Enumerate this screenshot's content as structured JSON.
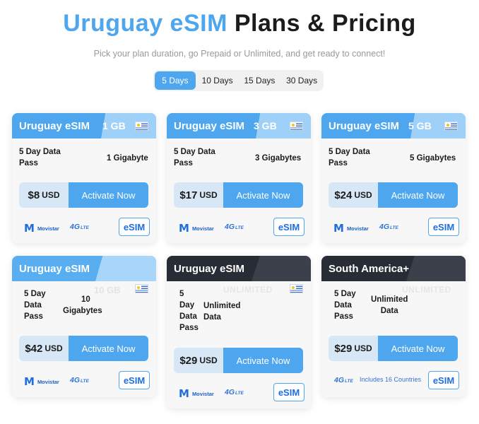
{
  "header": {
    "title_accent": "Uruguay eSIM",
    "title_rest": "Plans & Pricing",
    "subtitle": "Pick your plan duration, go Prepaid or Unlimited, and get ready to connect!"
  },
  "tabs": [
    {
      "label": "5 Days",
      "active": true
    },
    {
      "label": "10 Days",
      "active": false
    },
    {
      "label": "15 Days",
      "active": false
    },
    {
      "label": "30 Days",
      "active": false
    }
  ],
  "cards": [
    {
      "title": "Uruguay eSIM",
      "data_badge": "1 GB",
      "desc": [
        "5 Day Data",
        "Pass"
      ],
      "amount": [
        "1 Gigabyte"
      ],
      "price": "$8",
      "currency": "USD",
      "cta": "Activate Now",
      "carrier": "Movistar",
      "network": "4G",
      "network_sub": "LTE",
      "badge": "eSIM"
    },
    {
      "title": "Uruguay eSIM",
      "data_badge": "3 GB",
      "desc": [
        "5 Day Data",
        "Pass"
      ],
      "amount": [
        "3 Gigabytes"
      ],
      "price": "$17",
      "currency": "USD",
      "cta": "Activate Now",
      "carrier": "Movistar",
      "network": "4G",
      "network_sub": "LTE",
      "badge": "eSIM"
    },
    {
      "title": "Uruguay eSIM",
      "data_badge": "5 GB",
      "desc": [
        "5 Day Data",
        "Pass"
      ],
      "amount": [
        "5 Gigabytes"
      ],
      "price": "$24",
      "currency": "USD",
      "cta": "Activate Now",
      "carrier": "Movistar",
      "network": "4G",
      "network_sub": "LTE",
      "badge": "eSIM"
    },
    {
      "title": "Uruguay eSIM",
      "data_badge": "10 GB",
      "desc": [
        "5 Day",
        "Data",
        "Pass"
      ],
      "amount": [
        "10",
        "Gigabytes"
      ],
      "price": "$42",
      "currency": "USD",
      "cta": "Activate Now",
      "carrier": "Movistar",
      "network": "4G",
      "network_sub": "LTE",
      "badge": "eSIM"
    },
    {
      "title": "Uruguay eSIM",
      "data_badge": "UNLIMITED",
      "desc": [
        "5",
        "Day",
        "Data",
        "Pass"
      ],
      "amount": [
        "Unlimited",
        "Data"
      ],
      "price": "$29",
      "currency": "USD",
      "cta": "Activate Now",
      "carrier": "Movistar",
      "network": "4G",
      "network_sub": "LTE",
      "badge": "eSIM"
    },
    {
      "title": "South America+",
      "data_badge": "UNLIMITED",
      "desc": [
        "5 Day",
        "Data",
        "Pass"
      ],
      "amount": [
        "Unlimited",
        "Data"
      ],
      "price": "$29",
      "currency": "USD",
      "cta": "Activate Now",
      "network": "4G",
      "network_sub": "LTE",
      "includes": "Includes 16 Countries",
      "badge": "eSIM"
    }
  ]
}
